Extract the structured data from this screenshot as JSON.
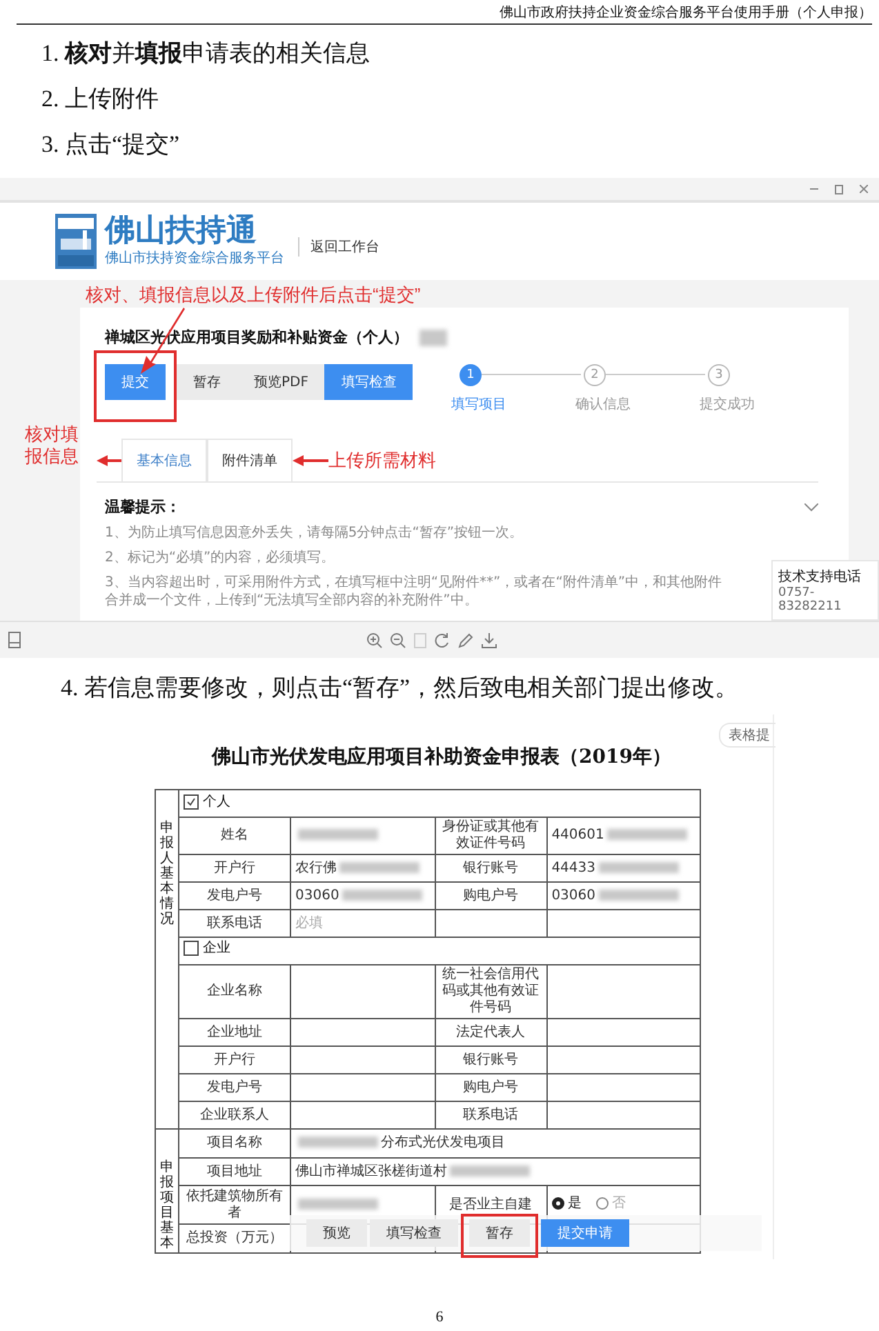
{
  "header": {
    "title": "佛山市政府扶持企业资金综合服务平台使用手册（个人申报）"
  },
  "steps": [
    "1. **核对**并**填报**申请表的相关信息",
    "2. 上传附件",
    "3. 点击“提交”"
  ],
  "screenshot_1": {
    "logo": {
      "name": "佛山扶持通",
      "subtitle": "佛山市扶持资金综合服务平台"
    },
    "back_link": "返回工作台",
    "callout_submit": "核对、填报信息以及上传附件后点击“提交”",
    "project_title": "禅城区光伏应用项目奖励和补贴资金（个人）",
    "buttons": [
      {
        "label": "提交",
        "kind": "primary",
        "highlighted": true
      },
      {
        "label": "暂存",
        "kind": "secondary",
        "highlighted": false
      },
      {
        "label": "预览PDF",
        "kind": "secondary",
        "highlighted": false
      },
      {
        "label": "填写检查",
        "kind": "primary",
        "highlighted": false
      }
    ],
    "stepper": [
      {
        "number": "1",
        "label": "填写项目",
        "selected": true
      },
      {
        "number": "2",
        "label": "确认信息",
        "selected": false
      },
      {
        "number": "3",
        "label": "提交成功",
        "selected": false
      }
    ],
    "callout_check": "核对填报信息",
    "tabs": [
      {
        "label": "基本信息",
        "selected": true
      },
      {
        "label": "附件清单",
        "selected": false
      }
    ],
    "callout_upload": "上传所需材料",
    "tips": {
      "title": "温馨提示：",
      "items": [
        "1、为防止填写信息因意外丢失，请每隔5分钟点击“暂存”按钮一次。",
        "2、标记为“必填”的内容，必须填写。",
        "3、当内容超出时，可采用附件方式，在填写框中注明“见附件**”，或者在“附件清单”中，和其他附件合并成一个文件，上传到“无法填写全部内容的补充附件”中。"
      ]
    },
    "support": {
      "label": "技术支持电话",
      "phone": "0757-83282211"
    }
  },
  "step_4": "4. 若信息需要修改，则点击“暂存”，然后致电相关部门提出修改。",
  "screenshot_2": {
    "side_tab": "表格提",
    "form_title": "佛山市光伏发电应用项目补助资金申报表（2019年）",
    "sections": [
      {
        "label": "申报人基本情况",
        "rows": [
          {
            "kind": "checkbox",
            "text": "个人",
            "checked": true
          },
          [
            {
              "kind": "label",
              "text": "姓名"
            },
            {
              "kind": "value",
              "blurred_before": true
            },
            {
              "kind": "label",
              "text": "身份证或其他有效证件号码"
            },
            {
              "kind": "value",
              "text": "440601",
              "blurred_after": true
            }
          ],
          [
            {
              "kind": "label",
              "text": "开户行"
            },
            {
              "kind": "value",
              "text": "农行佛",
              "blurred_after": true
            },
            {
              "kind": "label",
              "text": "银行账号"
            },
            {
              "kind": "value",
              "text": "44433",
              "blurred_after": true
            }
          ],
          [
            {
              "kind": "label",
              "text": "发电户号"
            },
            {
              "kind": "value",
              "text": "03060",
              "blurred_after": true
            },
            {
              "kind": "label",
              "text": "购电户号"
            },
            {
              "kind": "value",
              "text": "03060",
              "blurred_after": true
            }
          ],
          [
            {
              "kind": "label",
              "text": "联系电话"
            },
            {
              "kind": "placeholder",
              "text": "必填"
            },
            {
              "kind": "label"
            },
            {
              "kind": "value"
            }
          ],
          {
            "kind": "checkbox",
            "text": "企业",
            "checked": false
          },
          [
            {
              "kind": "label",
              "text": "企业名称"
            },
            {
              "kind": "value"
            },
            {
              "kind": "label",
              "text": "统一社会信用代码或其他有效证件号码"
            },
            {
              "kind": "value"
            }
          ],
          [
            {
              "kind": "label",
              "text": "企业地址"
            },
            {
              "kind": "value"
            },
            {
              "kind": "label",
              "text": "法定代表人"
            },
            {
              "kind": "value"
            }
          ],
          [
            {
              "kind": "label",
              "text": "开户行"
            },
            {
              "kind": "value"
            },
            {
              "kind": "label",
              "text": "银行账号"
            },
            {
              "kind": "value"
            }
          ],
          [
            {
              "kind": "label",
              "text": "发电户号"
            },
            {
              "kind": "value"
            },
            {
              "kind": "label",
              "text": "购电户号"
            },
            {
              "kind": "value"
            }
          ],
          [
            {
              "kind": "label",
              "text": "企业联系人"
            },
            {
              "kind": "value"
            },
            {
              "kind": "label",
              "text": "联系电话"
            },
            {
              "kind": "value"
            }
          ]
        ]
      },
      {
        "label": "申报项目基本",
        "rows": [
          [
            {
              "kind": "label",
              "text": "项目名称"
            },
            {
              "kind": "value",
              "text": "分布式光伏发电项目",
              "blurred_before": true,
              "colspan": 3
            }
          ],
          [
            {
              "kind": "label",
              "text": "项目地址"
            },
            {
              "kind": "value",
              "text": "佛山市禅城区张槎街道村",
              "blurred_after": true,
              "colspan": 3
            }
          ],
          [
            {
              "kind": "label",
              "text": "依托建筑物所有者"
            },
            {
              "kind": "value",
              "blurred_before": true
            },
            {
              "kind": "label",
              "text": "是否业主自建"
            },
            {
              "kind": "radio",
              "options": [
                {
                  "label": "是",
                  "selected": true
                },
                {
                  "label": "否",
                  "selected": false
                }
              ]
            }
          ],
          [
            {
              "kind": "label",
              "text": "总投资（万元）"
            },
            {
              "kind": "value"
            },
            {
              "kind": "label"
            },
            {
              "kind": "value"
            }
          ]
        ]
      }
    ],
    "bottom_buttons": [
      {
        "label": "预览",
        "kind": "secondary",
        "highlighted": false
      },
      {
        "label": "填写检查",
        "kind": "secondary",
        "highlighted": false
      },
      {
        "label": "暂存",
        "kind": "secondary",
        "highlighted": true
      },
      {
        "label": "提交申请",
        "kind": "primary",
        "highlighted": false
      }
    ]
  },
  "page_number": "6"
}
